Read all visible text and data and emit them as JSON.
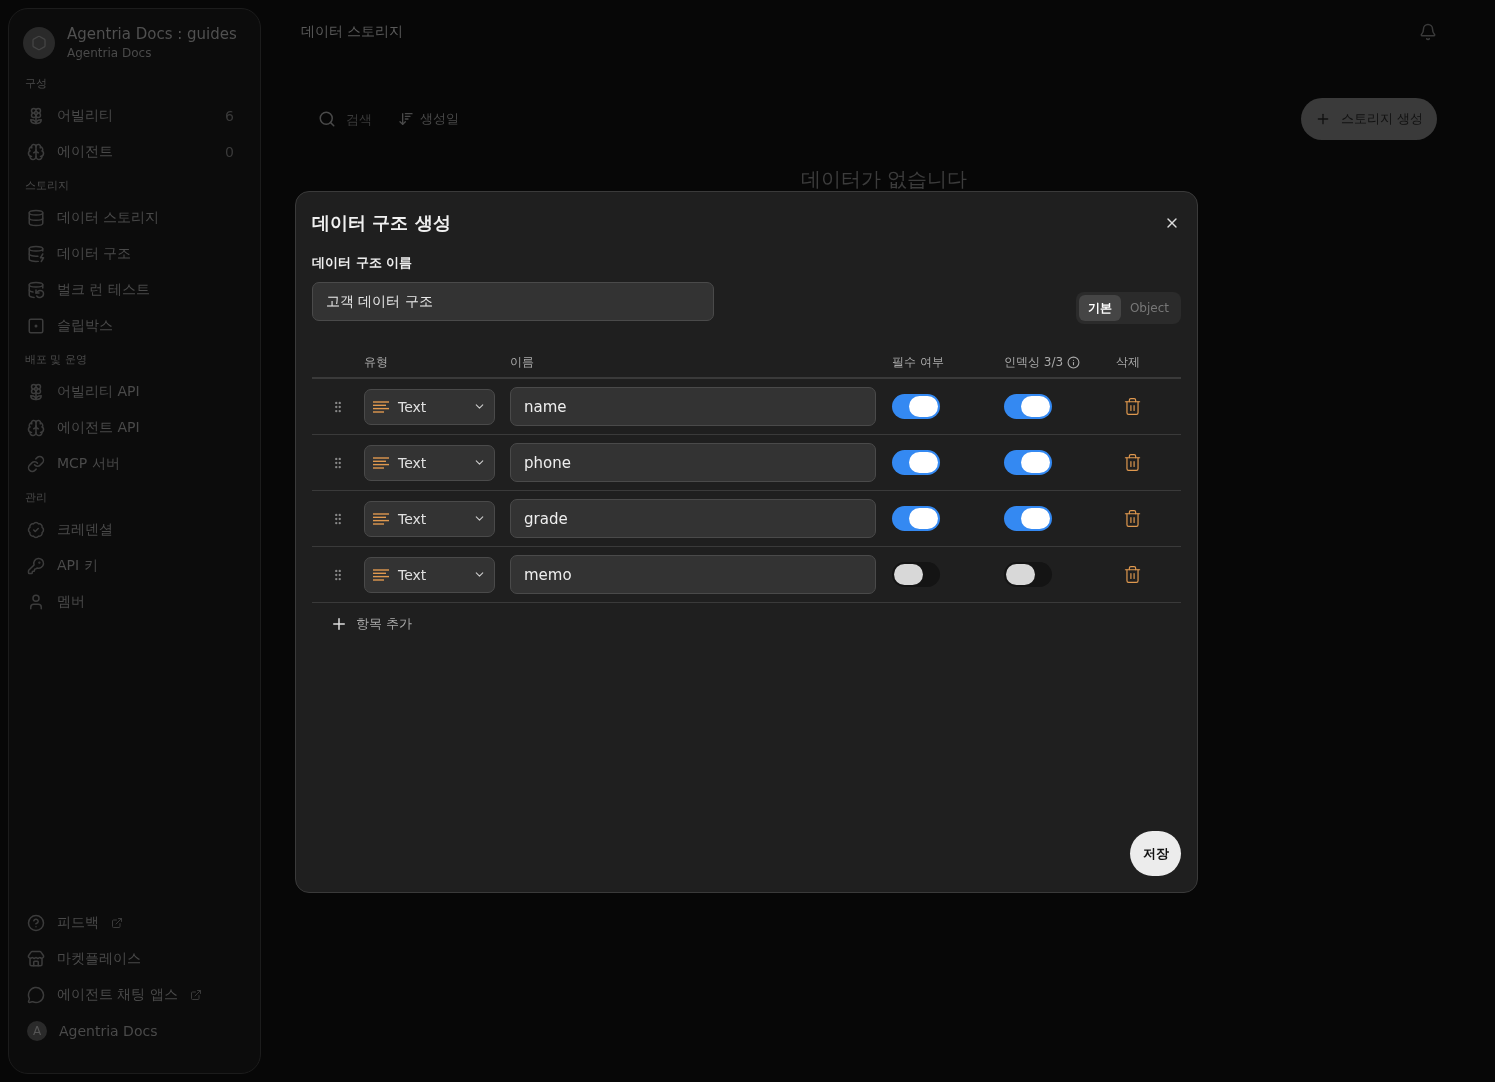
{
  "sidebar": {
    "workspace": {
      "title": "Agentria Docs : guides",
      "subtitle": "Agentria Docs"
    },
    "sections": [
      {
        "label": "구성",
        "items": [
          {
            "label": "어빌리티",
            "count": "6"
          },
          {
            "label": "에이전트",
            "count": "0"
          }
        ]
      },
      {
        "label": "스토리지",
        "items": [
          {
            "label": "데이터 스토리지"
          },
          {
            "label": "데이터 구조"
          },
          {
            "label": "벌크 런 테스트"
          },
          {
            "label": "슬립박스"
          }
        ]
      },
      {
        "label": "배포 및 운영",
        "items": [
          {
            "label": "어빌리티 API"
          },
          {
            "label": "에이전트 API"
          },
          {
            "label": "MCP 서버"
          }
        ]
      },
      {
        "label": "관리",
        "items": [
          {
            "label": "크레덴셜"
          },
          {
            "label": "API 키"
          },
          {
            "label": "멤버"
          }
        ]
      }
    ],
    "footer_items": [
      {
        "label": "피드백",
        "external": true
      },
      {
        "label": "마켓플레이스",
        "external": false
      },
      {
        "label": "에이전트 채팅 앱스",
        "external": true
      }
    ],
    "user": {
      "avatar": "A",
      "name": "Agentria Docs"
    }
  },
  "header": {
    "title": "데이터 스토리지"
  },
  "toolbar": {
    "search_placeholder": "검색",
    "sort": "생성일",
    "create_button": "스토리지 생성"
  },
  "empty_message": "데이터가 없습니다",
  "dialog": {
    "title": "데이터 구조 생성",
    "name_label": "데이터 구조 이름",
    "name_value": "고객 데이터 구조",
    "mode_tabs": [
      {
        "label": "기본",
        "selected": true
      },
      {
        "label": "Object",
        "selected": false
      }
    ],
    "columns": [
      "유형",
      "이름",
      "필수 여부",
      "인덱싱 3/3",
      "삭제"
    ],
    "fields": [
      {
        "type": "Text",
        "name": "name",
        "required": true,
        "indexed": true
      },
      {
        "type": "Text",
        "name": "phone",
        "required": true,
        "indexed": true
      },
      {
        "type": "Text",
        "name": "grade",
        "required": true,
        "indexed": true
      },
      {
        "type": "Text",
        "name": "memo",
        "required": false,
        "indexed": false
      }
    ],
    "add_button": "항목 추가",
    "save_button": "저장"
  }
}
